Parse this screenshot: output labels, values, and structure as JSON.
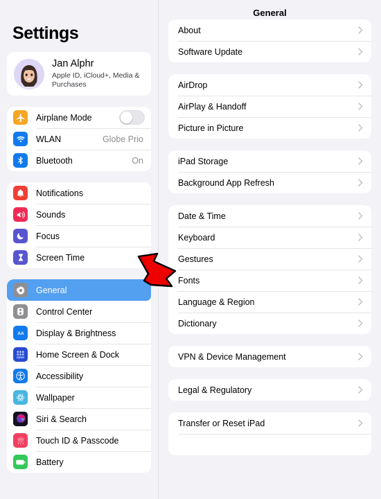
{
  "sidebar": {
    "title": "Settings",
    "account": {
      "name": "Jan Alphr",
      "subtitle": "Apple ID, iCloud+, Media & Purchases",
      "avatar_icon": "memoji-avatar"
    },
    "groups": [
      {
        "items": [
          {
            "label": "Airplane Mode",
            "icon": "airplane-icon",
            "icon_color": "#f5a623",
            "control": "toggle",
            "toggle_on": false
          },
          {
            "label": "WLAN",
            "icon": "wifi-icon",
            "icon_color": "#127aec",
            "value": "Globe Prio"
          },
          {
            "label": "Bluetooth",
            "icon": "bluetooth-icon",
            "icon_color": "#127aec",
            "value": "On"
          }
        ]
      },
      {
        "items": [
          {
            "label": "Notifications",
            "icon": "bell-icon",
            "icon_color": "#ef4036"
          },
          {
            "label": "Sounds",
            "icon": "speaker-icon",
            "icon_color": "#ee2b55"
          },
          {
            "label": "Focus",
            "icon": "moon-icon",
            "icon_color": "#5856cf"
          },
          {
            "label": "Screen Time",
            "icon": "hourglass-icon",
            "icon_color": "#5856cf"
          }
        ]
      },
      {
        "items": [
          {
            "label": "General",
            "icon": "gear-icon",
            "icon_color": "#8e8e93",
            "selected": true
          },
          {
            "label": "Control Center",
            "icon": "control-center-icon",
            "icon_color": "#8e8e93"
          },
          {
            "label": "Display & Brightness",
            "icon": "display-brightness-icon",
            "icon_color": "#127aec"
          },
          {
            "label": "Home Screen & Dock",
            "icon": "home-screen-dock-icon",
            "icon_color": "#2a4bd0"
          },
          {
            "label": "Accessibility",
            "icon": "accessibility-icon",
            "icon_color": "#127aec"
          },
          {
            "label": "Wallpaper",
            "icon": "wallpaper-icon",
            "icon_color": "#47b7e0"
          },
          {
            "label": "Siri & Search",
            "icon": "siri-icon",
            "icon_color": "#1c1c2e"
          },
          {
            "label": "Touch ID & Passcode",
            "icon": "touch-id-icon",
            "icon_color": "#ef4060"
          },
          {
            "label": "Battery",
            "icon": "battery-icon",
            "icon_color": "#34c759"
          }
        ]
      }
    ],
    "selected_accent": "#539ff0"
  },
  "detail": {
    "title": "General",
    "groups": [
      {
        "items": [
          {
            "label": "About",
            "chevron": "chevron-right-icon"
          },
          {
            "label": "Software Update",
            "chevron": "chevron-right-icon"
          }
        ]
      },
      {
        "items": [
          {
            "label": "AirDrop",
            "chevron": "chevron-right-icon"
          },
          {
            "label": "AirPlay & Handoff",
            "chevron": "chevron-right-icon"
          },
          {
            "label": "Picture in Picture",
            "chevron": "chevron-right-icon"
          }
        ]
      },
      {
        "items": [
          {
            "label": "iPad Storage",
            "chevron": "chevron-right-icon"
          },
          {
            "label": "Background App Refresh",
            "chevron": "chevron-right-icon"
          }
        ]
      },
      {
        "items": [
          {
            "label": "Date & Time",
            "chevron": "chevron-right-icon"
          },
          {
            "label": "Keyboard",
            "chevron": "chevron-right-icon"
          },
          {
            "label": "Gestures",
            "chevron": "chevron-right-icon"
          },
          {
            "label": "Fonts",
            "chevron": "chevron-right-icon"
          },
          {
            "label": "Language & Region",
            "chevron": "chevron-right-icon"
          },
          {
            "label": "Dictionary",
            "chevron": "chevron-right-icon"
          }
        ]
      },
      {
        "items": [
          {
            "label": "VPN & Device Management",
            "chevron": "chevron-right-icon"
          }
        ]
      },
      {
        "items": [
          {
            "label": "Legal & Regulatory",
            "chevron": "chevron-right-icon"
          }
        ]
      },
      {
        "items": [
          {
            "label": "Transfer or Reset iPad",
            "chevron": "chevron-right-icon"
          }
        ]
      }
    ]
  },
  "annotation": {
    "arrow_icon": "red-arrow-pointer",
    "points_at": "Keyboard",
    "color": "#ee0000",
    "outline": "#000000"
  }
}
